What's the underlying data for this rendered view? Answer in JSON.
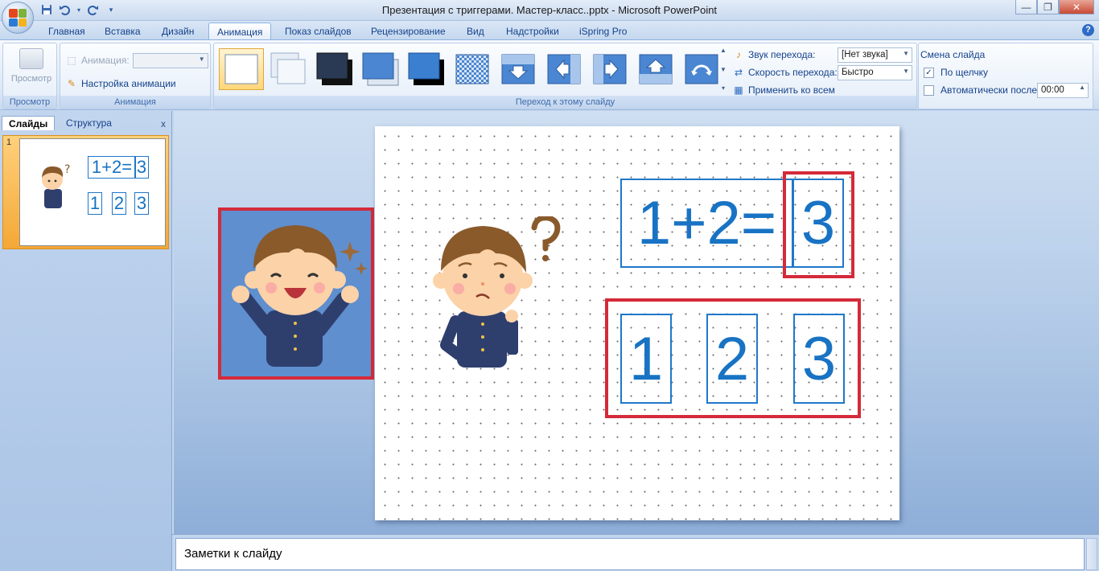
{
  "window": {
    "title": "Презентация с триггерами. Мастер-класс..pptx - Microsoft PowerPoint",
    "minimize_glyph": "—",
    "maximize_glyph": "❐",
    "close_glyph": "✕"
  },
  "qat": {
    "save_icon": "save-icon",
    "undo_icon": "undo-icon",
    "redo_icon": "redo-icon",
    "customize_glyph": "▾"
  },
  "tabs": [
    {
      "label": "Главная"
    },
    {
      "label": "Вставка"
    },
    {
      "label": "Дизайн"
    },
    {
      "label": "Анимация",
      "active": true
    },
    {
      "label": "Показ слайдов"
    },
    {
      "label": "Рецензирование"
    },
    {
      "label": "Вид"
    },
    {
      "label": "Надстройки"
    },
    {
      "label": "iSpring Pro"
    }
  ],
  "ribbon": {
    "preview_group": {
      "button_label": "Просмотр",
      "group_label": "Просмотр"
    },
    "animation_group": {
      "animation_label": "Анимация:",
      "animation_value": "",
      "custom_animation_label": "Настройка анимации",
      "group_label": "Анимация"
    },
    "transition_group": {
      "group_label": "Переход к этому слайду",
      "sound_label": "Звук перехода:",
      "sound_value": "[Нет звука]",
      "speed_label": "Скорость перехода:",
      "speed_value": "Быстро",
      "apply_all_label": "Применить ко всем"
    },
    "advance_group": {
      "title": "Смена слайда",
      "on_click_label": "По щелчку",
      "on_click_checked": true,
      "auto_after_label": "Автоматически после:",
      "auto_after_checked": false,
      "auto_after_value": "00:00"
    }
  },
  "left_pane": {
    "tab_slides": "Слайды",
    "tab_outline": "Структура",
    "close_glyph": "x",
    "slide_number": "1"
  },
  "slide": {
    "equation": "1+2=",
    "answer": "3",
    "options": [
      "1",
      "2",
      "3"
    ]
  },
  "notes": {
    "placeholder": "Заметки к слайду"
  },
  "colors": {
    "accent_blue": "#1f78c8",
    "highlight_red": "#d42a3a",
    "selected_tab": "#ffd67a"
  }
}
